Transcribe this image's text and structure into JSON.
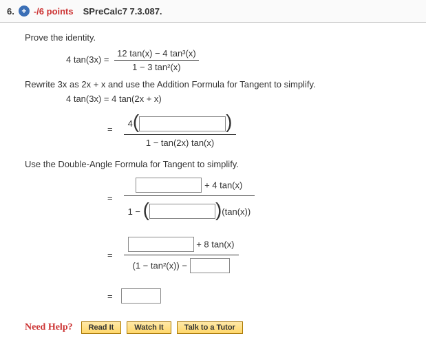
{
  "header": {
    "number": "6.",
    "plus": "+",
    "points": "-/6 points",
    "source": "SPreCalc7 7.3.087."
  },
  "lines": {
    "prove": "Prove the identity.",
    "identity_left": "4 tan(3x) =",
    "identity_num": "12 tan(x) − 4 tan³(x)",
    "identity_den": "1 − 3 tan²(x)",
    "rewrite": "Rewrite 3x as 2x + x and use the Addition Formula for Tangent to simplify.",
    "step1_left": "4 tan(3x)  =  4 tan(2x + x)",
    "step2_pre4": "4",
    "step2_den": "1 − tan(2x) tan(x)",
    "double": "Use the Double-Angle Formula for Tangent to simplify.",
    "step3_num_suffix": " + 4 tan(x)",
    "step3_den_pre": "1 − ",
    "step3_den_suffix": "(tan(x))",
    "step4_num_suffix": " + 8 tan(x)",
    "step4_den_pre": "(1 − tan²(x)) − "
  },
  "help": {
    "label": "Need Help?",
    "read": "Read It",
    "watch": "Watch It",
    "tutor": "Talk to a Tutor"
  }
}
